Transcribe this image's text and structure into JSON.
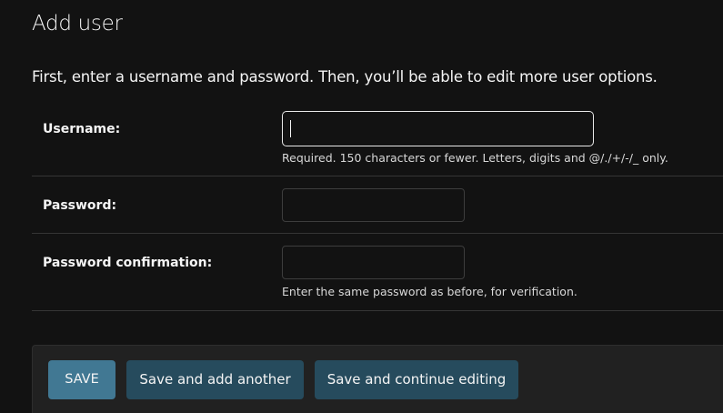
{
  "page": {
    "title": "Add user",
    "intro": "First, enter a username and password. Then, you’ll be able to edit more user options."
  },
  "form": {
    "username": {
      "label": "Username:",
      "value": "",
      "help": "Required. 150 characters or fewer. Letters, digits and @/./+/-/_ only."
    },
    "password": {
      "label": "Password:",
      "value": ""
    },
    "password_confirmation": {
      "label": "Password confirmation:",
      "value": "",
      "help": "Enter the same password as before, for verification."
    }
  },
  "submit_row": {
    "save_label": "SAVE",
    "save_add_another_label": "Save and add another",
    "save_continue_label": "Save and continue editing"
  },
  "colors": {
    "background": "#121212",
    "primary_button": "#417893",
    "secondary_button": "#264b5d",
    "focused_border": "#e8e8e8"
  }
}
